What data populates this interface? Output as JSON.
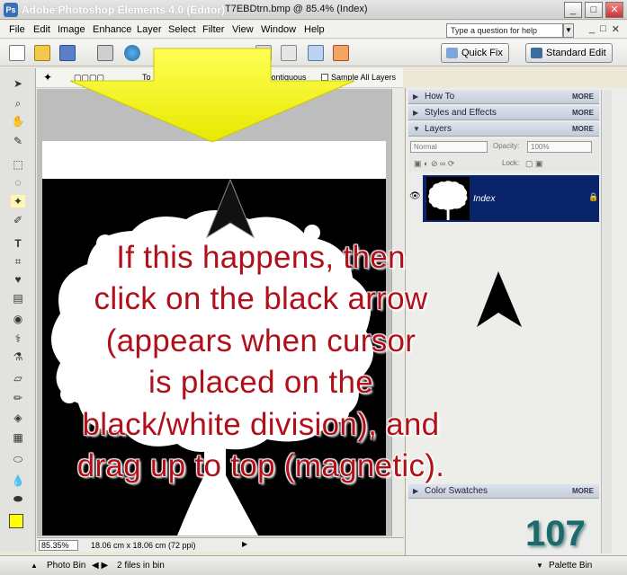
{
  "window": {
    "app_title": "Adobe Photoshop Elements 4.0 (Editor)",
    "doc_title": "T7EBDtrn.bmp @ 85.4% (Index)",
    "controls": [
      "_",
      "□",
      "✕"
    ]
  },
  "menu": {
    "items": [
      "File",
      "Edit",
      "Image",
      "Enhance",
      "Layer",
      "Select",
      "Filter",
      "View",
      "Window",
      "Help"
    ],
    "help_placeholder": "Type a question for help",
    "mdi_controls": [
      "_",
      "□",
      "✕"
    ]
  },
  "toolbar": {
    "quick_fix": "Quick Fix",
    "standard_edit": "Standard Edit"
  },
  "options_bar": {
    "partial_label": "To",
    "contiguous": "Contiguous",
    "sample_all_layers": "Sample All Layers"
  },
  "palette": {
    "panels": [
      {
        "title": "How To",
        "more": "MORE"
      },
      {
        "title": "Styles and Effects",
        "more": "MORE"
      },
      {
        "title": "Layers",
        "more": "MORE"
      }
    ],
    "blend_mode": "Normal",
    "opacity_label": "Opacity:",
    "opacity_value": "100%",
    "lock_label": "Lock:",
    "layer_name": "Index",
    "color_swatches": {
      "title": "Color Swatches",
      "more": "MORE"
    }
  },
  "status": {
    "zoom": "85.35%",
    "info": "18.06 cm x 18.06 cm (72 ppi)"
  },
  "bottom": {
    "photo_bin": "Photo Bin",
    "files_in_bin": "2 files in bin",
    "palette_bin": "Palette Bin"
  },
  "overlay": {
    "callout_lines": [
      "If this happens, then",
      "click on the black arrow",
      "(appears when cursor",
      "is placed on the",
      "black/white division), and",
      "drag up to top (magnetic)."
    ],
    "page_number": "107"
  },
  "colors": {
    "foreground_swatch": "#ffff00",
    "background_swatch": "#000000",
    "callout_text": "#b0101a",
    "big_arrow": "#ffff00",
    "layer_selected": "#0a246a"
  }
}
